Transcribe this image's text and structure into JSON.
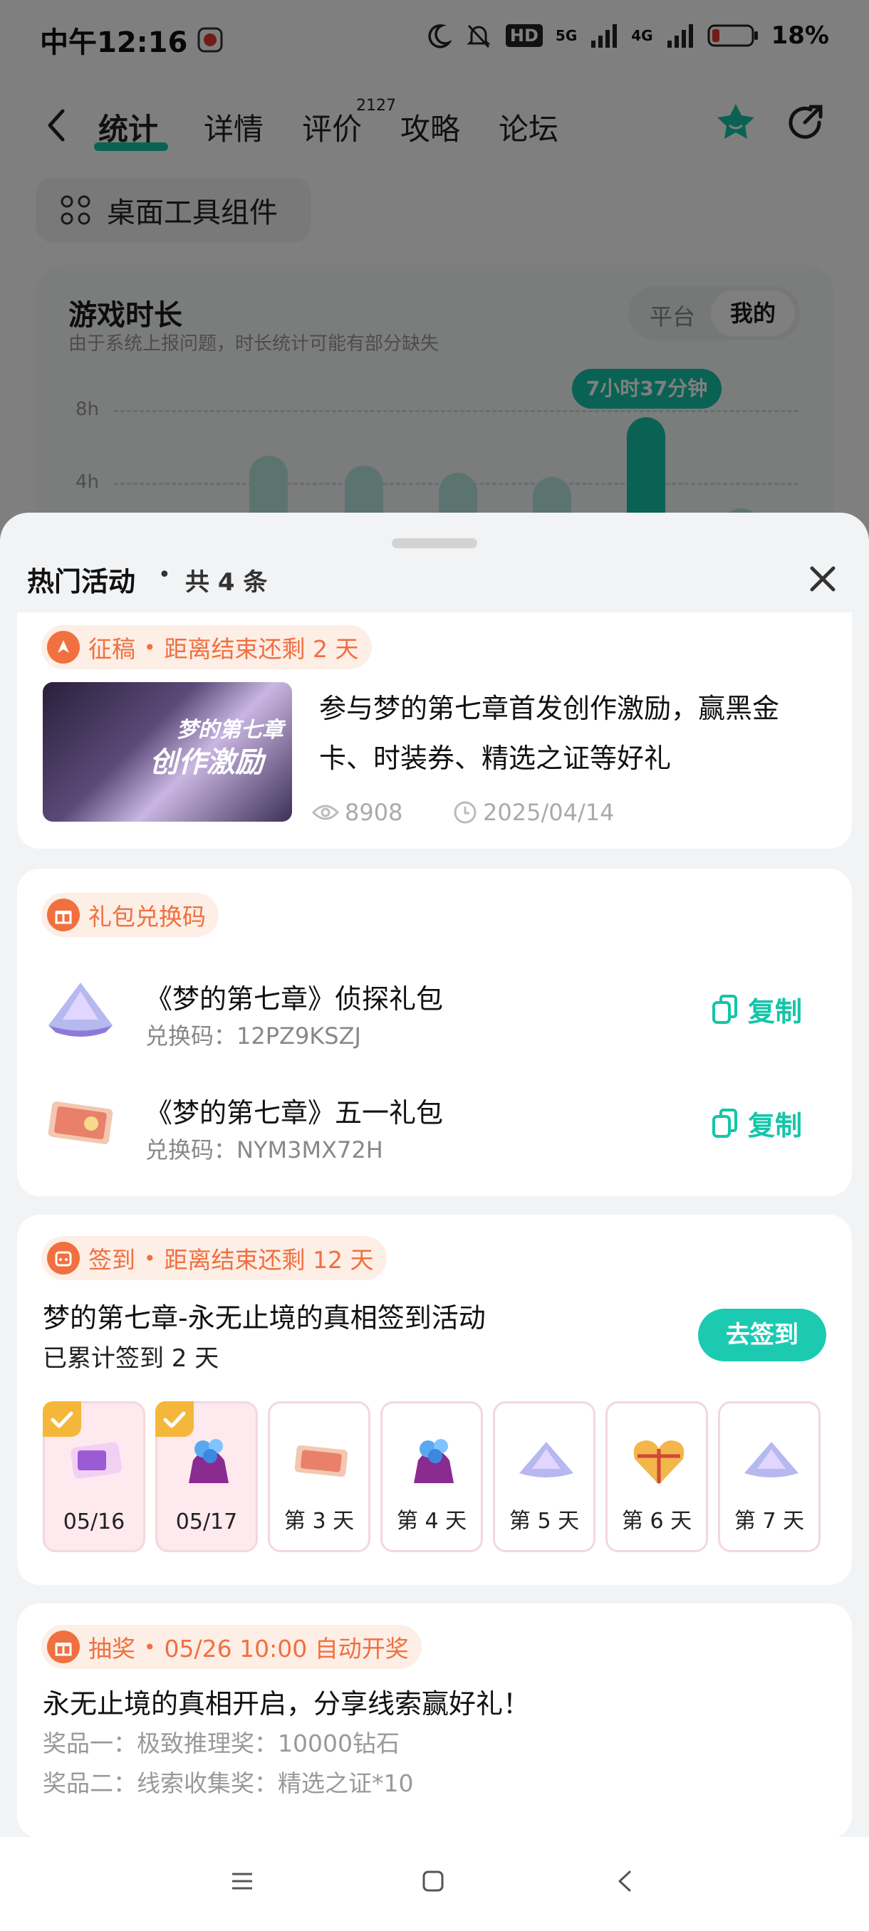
{
  "status_bar": {
    "time": "中午12:16",
    "network_5g": "5G",
    "network_4g": "4G",
    "battery": "18%",
    "hd": "HD"
  },
  "nav": {
    "tabs": [
      {
        "label": "统计",
        "active": true
      },
      {
        "label": "详情",
        "active": false
      },
      {
        "label": "评价",
        "active": false
      },
      {
        "label": "攻略",
        "active": false
      },
      {
        "label": "论坛",
        "active": false
      }
    ],
    "review_count": "2127"
  },
  "widget_button": "桌面工具组件",
  "game_time": {
    "title": "游戏时长",
    "note": "由于系统上报问题，时长统计可能有部分缺失",
    "toggle": [
      "平台",
      "我的"
    ],
    "y_labels": [
      "8h",
      "4h"
    ],
    "highlight": "7小时37分钟"
  },
  "sheet": {
    "title": "热门活动",
    "count": "共 4 条",
    "bullet": "•"
  },
  "activity_post": {
    "tag": "征稿",
    "remaining": "距离结束还剩 2 天",
    "title": "参与梦的第七章首发创作激励，赢黑金卡、时装券、精选之证等好礼",
    "views": "8908",
    "date": "2025/04/14",
    "thumb_line1": "梦的第七章",
    "thumb_line2": "创作激励"
  },
  "gift_codes": {
    "tag": "礼包兑换码",
    "copy_label": "复制",
    "items": [
      {
        "name": "《梦的第七章》侦探礼包",
        "code": "兑换码：12PZ9KSZJ"
      },
      {
        "name": "《梦的第七章》五一礼包",
        "code": "兑换码：NYM3MX72H"
      }
    ]
  },
  "sign_in": {
    "tag": "签到",
    "remaining": "距离结束还剩 12 天",
    "title": "梦的第七章-永无止境的真相签到活动",
    "progress": "已累计签到 2 天",
    "button": "去签到",
    "days": [
      {
        "label": "05/16",
        "done": true
      },
      {
        "label": "05/17",
        "done": true
      },
      {
        "label": "第 3 天",
        "done": false
      },
      {
        "label": "第 4 天",
        "done": false
      },
      {
        "label": "第 5 天",
        "done": false
      },
      {
        "label": "第 6 天",
        "done": false
      },
      {
        "label": "第 7 天",
        "done": false
      }
    ]
  },
  "lottery": {
    "tag": "抽奖",
    "draw_time": "05/26 10:00 自动开奖",
    "title": "永无止境的真相开启，分享线索赢好礼！",
    "prize1": "奖品一：极致推理奖：10000钻石",
    "prize2": "奖品二：线索收集奖：精选之证*10"
  },
  "colors": {
    "accent": "#15c5a8",
    "tag_orange": "#f0703f",
    "tag_bg": "#fdeee6"
  }
}
